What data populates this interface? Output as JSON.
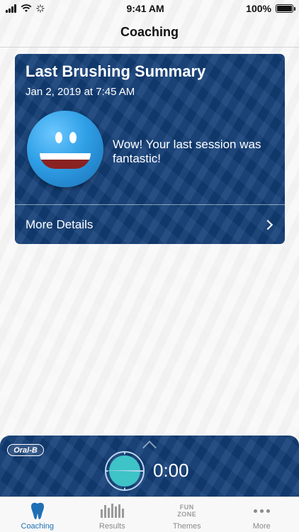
{
  "status_bar": {
    "time": "9:41 AM",
    "battery_pct": "100%"
  },
  "nav": {
    "title": "Coaching"
  },
  "summary_card": {
    "title": "Last Brushing Summary",
    "date": "Jan 2, 2019 at 7:45 AM",
    "message": "Wow! Your last session was fantastic!",
    "more_details_label": "More Details"
  },
  "timer": {
    "brand": "Oral-B",
    "time": "0:00"
  },
  "tabs": [
    {
      "label": "Coaching",
      "icon": "tooth-icon",
      "active": true
    },
    {
      "label": "Results",
      "icon": "bar-chart-icon",
      "active": false
    },
    {
      "label": "Themes",
      "icon": "fun-zone-icon",
      "icon_text": [
        "FUN",
        "ZONE"
      ],
      "active": false
    },
    {
      "label": "More",
      "icon": "ellipsis-icon",
      "active": false
    }
  ],
  "colors": {
    "card_blue": "#123e77",
    "accent_blue": "#1f6fb5",
    "timer_teal": "#3ec3c7"
  }
}
